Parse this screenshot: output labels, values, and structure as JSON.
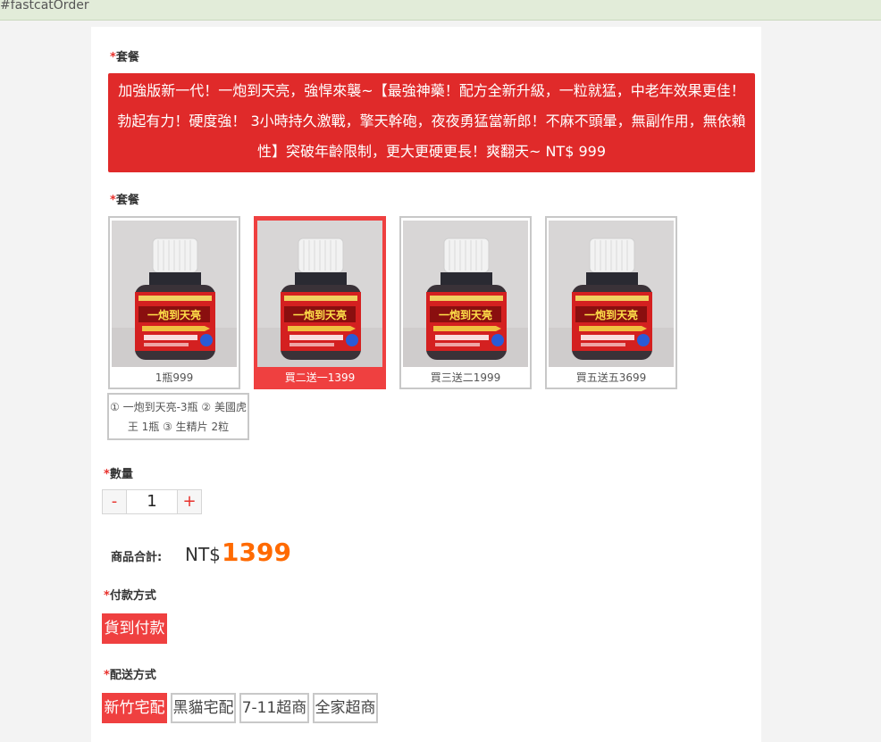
{
  "window": {
    "title": "#fastcatOrder"
  },
  "package_section": {
    "label": "套餐",
    "banner": "加強版新一代！一炮到天亮，強悍來襲~【最強神藥！配方全新升級，一粒就猛，中老年效果更佳！勃起有力！硬度強！ 3小時持久激戰，擎天幹砲，夜夜勇猛當新郎！不麻不頭暈，無副作用，無依賴性】突破年齡限制，更大更硬更長！爽翻天~ NT$ 999"
  },
  "options_section": {
    "label": "套餐",
    "options": [
      {
        "caption": "1瓶999",
        "selected": false
      },
      {
        "caption": "買二送一1399",
        "selected": true
      },
      {
        "caption": "買三送二1999",
        "selected": false
      },
      {
        "caption": "買五送五3699",
        "selected": false
      }
    ],
    "note": "① 一炮到天亮-3瓶 ② 美國虎王 1瓶 ③ 生精片 2粒"
  },
  "quantity": {
    "label": "數量",
    "minus": "-",
    "value": "1",
    "plus": "+"
  },
  "total": {
    "label": "商品合計:",
    "currency": "NT$",
    "amount": "1399"
  },
  "payment": {
    "label": "付款方式",
    "options": [
      "貨到付款"
    ]
  },
  "shipping": {
    "label": "配送方式",
    "options": [
      "新竹宅配",
      "黑貓宅配",
      "7-11超商",
      "全家超商"
    ]
  },
  "colors": {
    "accent": "#ef4040",
    "banner": "#e02a2a",
    "price": "#ff6a00",
    "required_star": "#e8312c"
  },
  "product_image": {
    "bottle_text": "一炮到天亮",
    "cap_color": "#f2f2f2",
    "label_color": "#d42020"
  }
}
